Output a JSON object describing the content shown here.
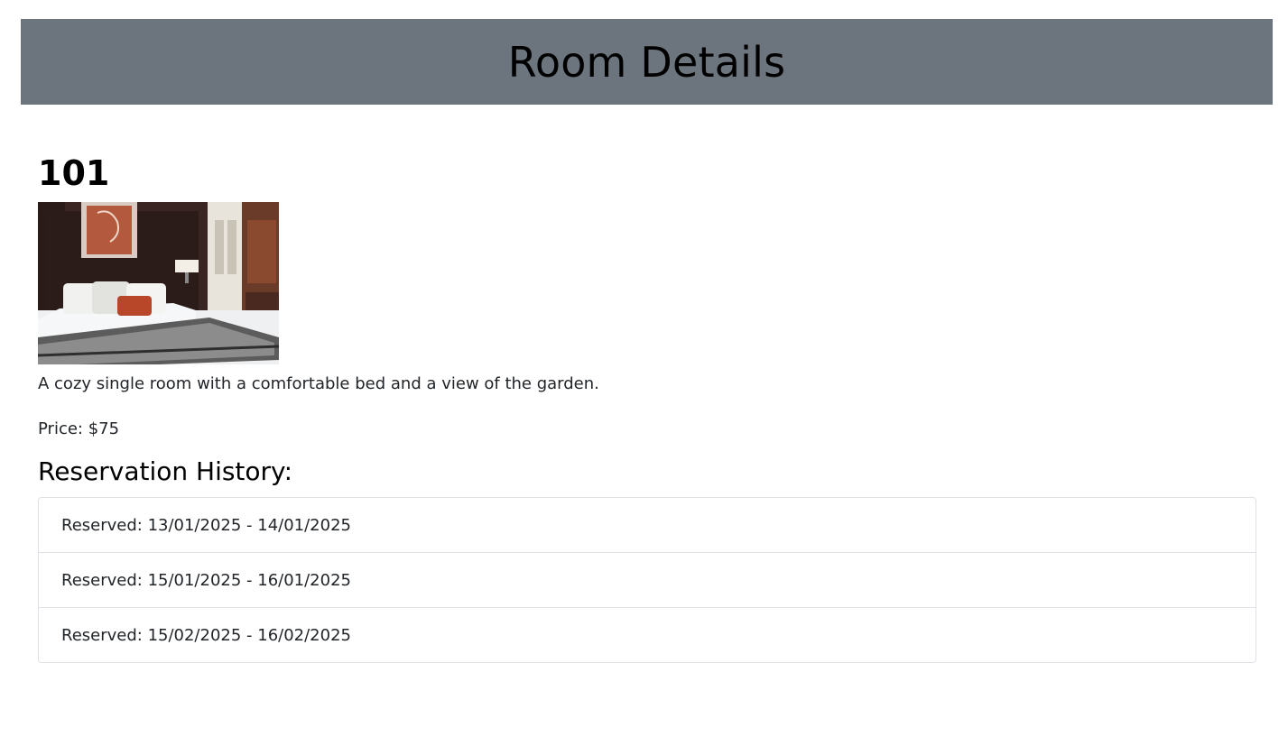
{
  "header": {
    "title": "Room Details"
  },
  "room": {
    "number": "101",
    "description": "A cozy single room with a comfortable bed and a view of the garden.",
    "price_text": "Price: $75"
  },
  "history": {
    "title": "Reservation History:",
    "items": [
      "Reserved: 13/01/2025 - 14/01/2025",
      "Reserved: 15/01/2025 - 16/01/2025",
      "Reserved: 15/02/2025 - 16/02/2025"
    ]
  },
  "colors": {
    "header_bg": "#6c757d",
    "border": "#dee2e6",
    "text": "#212529"
  }
}
